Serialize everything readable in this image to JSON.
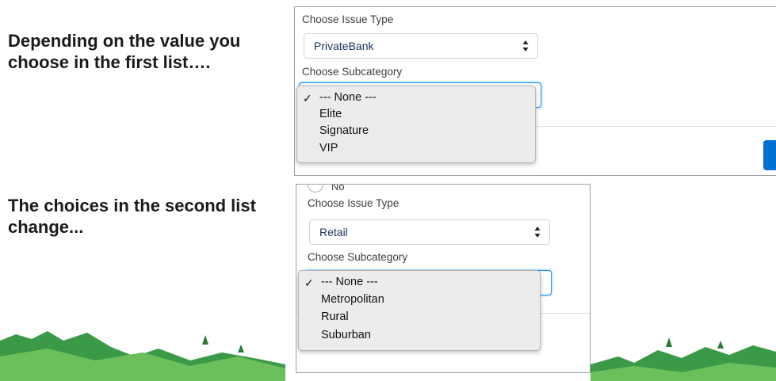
{
  "captions": {
    "first": "Depending on the value you choose in the first list….",
    "second": "The choices in the second list change..."
  },
  "panel_top": {
    "issue_type_label": "Choose Issue Type",
    "issue_type_value": "PrivateBank",
    "subcategory_label": "Choose Subcategory",
    "subcategory_options": [
      "--- None ---",
      "Elite",
      "Signature",
      "VIP"
    ],
    "selected_mark": "✓"
  },
  "panel_bottom": {
    "radio_label": "No",
    "issue_type_label": "Choose Issue Type",
    "issue_type_value": "Retail",
    "subcategory_label": "Choose Subcategory",
    "subcategory_options": [
      "--- None ---",
      "Metropolitan",
      "Rural",
      "Suburban"
    ],
    "selected_mark": "✓"
  },
  "colors": {
    "accent": "#0070d2",
    "focus": "#1b96ff",
    "mountain_dark": "#2e8b3d",
    "mountain_light": "#5cb85c"
  },
  "icons": {
    "select_arrows": "updown-arrows-icon",
    "checkmark": "checkmark-icon"
  }
}
